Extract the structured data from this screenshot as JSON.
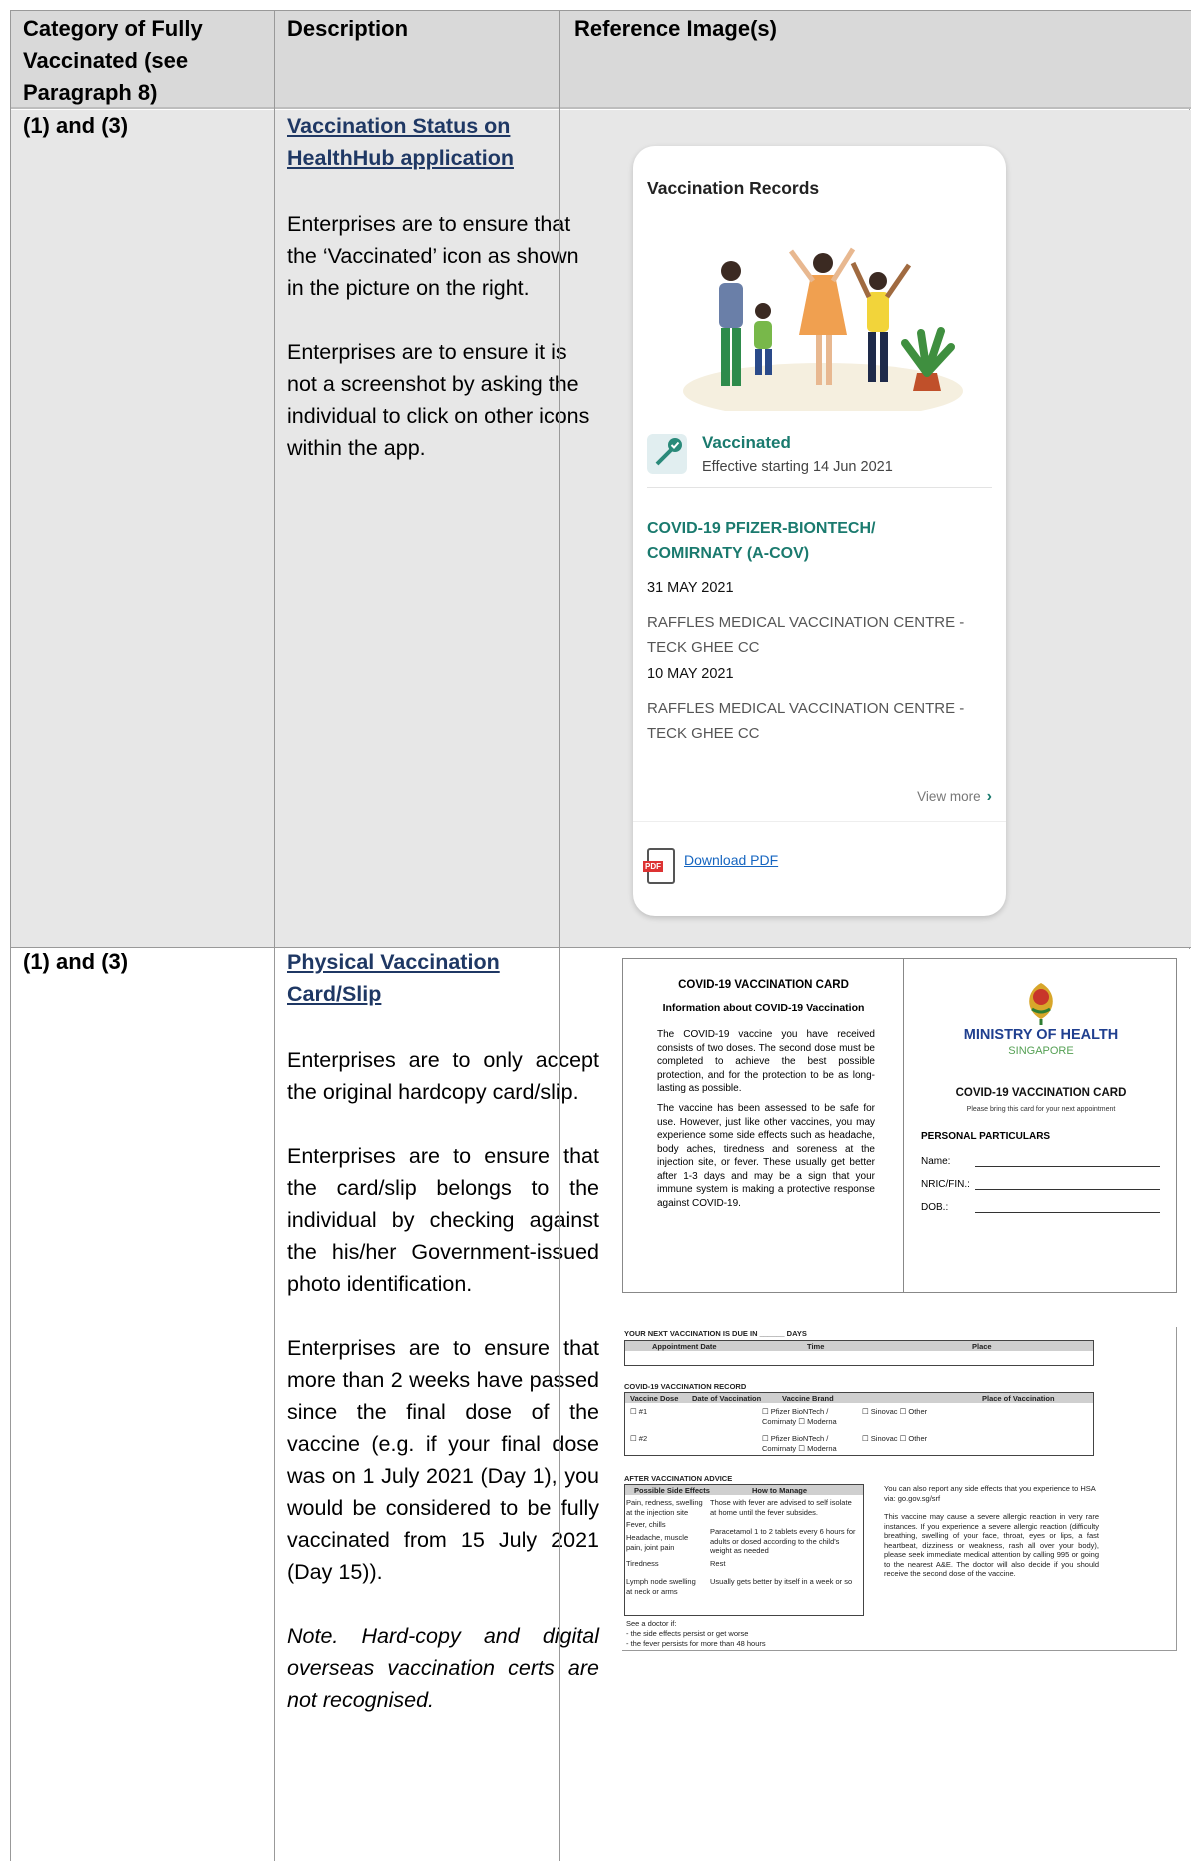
{
  "header": {
    "col1": "Category of Fully Vaccinated (see Paragraph 8)",
    "col2": "Description",
    "col3": "Reference Image(s)"
  },
  "row1": {
    "category": "(1) and (3)",
    "title": "Vaccination Status on HealthHub application",
    "para1": "Enterprises are to ensure that the ‘Vaccinated’ icon as shown in the picture on the right.",
    "para2": "Enterprises are to ensure it is not a screenshot by asking the individual to click on other icons within the app."
  },
  "app_card": {
    "heading": "Vaccination Records",
    "status": "Vaccinated",
    "effective": "Effective starting 14 Jun 2021",
    "vaccine": "COVID-19 PFIZER-BIONTECH/ COMIRNATY (A-COV)",
    "date1": "31 MAY 2021",
    "place1": "RAFFLES MEDICAL VACCINATION CENTRE - TECK GHEE CC",
    "date2": "10 MAY 2021",
    "place2": "RAFFLES MEDICAL VACCINATION CENTRE - TECK GHEE CC",
    "view_more": "View more",
    "pdf_badge": "PDF",
    "download": "Download PDF"
  },
  "row2": {
    "category": "(1) and (3)",
    "title": "Physical Vaccination Card/Slip",
    "para1": "Enterprises are to only accept the original hardcopy card/slip.",
    "para2": "Enterprises are to ensure that the card/slip belongs to the individual by checking against the his/her Government-issued photo identification.",
    "para3": "Enterprises are to ensure that more than 2 weeks have passed since the final dose of the vaccine (e.g. if your final dose was on 1 July 2021 (Day 1), you would be considered to be fully vaccinated from 15 July 2021 (Day 15)).",
    "note": "Note. Hard-copy and digital overseas vaccination certs are not recognised."
  },
  "phys_card": {
    "left_title": "COVID-19 VACCINATION CARD",
    "left_subtitle": "Information about COVID-19 Vaccination",
    "text1": "The COVID-19 vaccine you have received consists of two doses. The second dose must be completed to achieve the best possible protection, and for the protection to be as long-lasting as possible.",
    "text2": "The vaccine has been assessed to be safe for use. However, just like other vaccines, you may experience some side effects such as headache, body aches, tiredness and soreness at the injection site, or fever. These usually get better after 1-3 days and may be a sign that your immune system is making a protective response against COVID-19.",
    "ministry": "MINISTRY OF HEALTH",
    "country": "SINGAPORE",
    "right_title": "COVID-19 VACCINATION CARD",
    "right_note": "Please bring this card for your next appointment",
    "particulars": "PERSONAL PARTICULARS",
    "name": "Name:",
    "nric": "NRIC/FIN.:",
    "dob": "DOB.:"
  },
  "record_sheet": {
    "next_due": "YOUR NEXT VACCINATION IS DUE IN ______ DAYS",
    "appt": "Appointment Date",
    "time": "Time",
    "place": "Place",
    "record_title": "COVID-19 VACCINATION RECORD",
    "dose": "Vaccine Dose",
    "date": "Date of Vaccination",
    "brand": "Vaccine Brand",
    "place_vacc": "Place of Vaccination",
    "dose1": "☐ #1",
    "dose2": "☐ #2",
    "brand_opts": "☐ Pfizer BioNTech / Comirnaty ☐ Moderna",
    "brand_opts2": "☐ Sinovac ☐ Other",
    "advice": "AFTER VACCINATION ADVICE",
    "side": "Possible Side Effects",
    "manage": "How to Manage",
    "s1": "Pain, redness, swelling at the injection site",
    "s2": "Fever, chills",
    "s3": "Headache, muscle pain, joint pain",
    "s4": "Tiredness",
    "s5": "Lymph node swelling at neck or arms",
    "m1": "Those with fever are advised to self isolate at home until the fever subsides.",
    "m2": "Paracetamol 1 to 2 tablets every 6 hours for adults or dosed according to the child's weight as needed",
    "m3": "Rest",
    "m4": "Usually gets better by itself in a week or so",
    "report": "You can also report any side effects that you experience to HSA via: go.gov.sg/srf",
    "allergy": "This vaccine may cause a severe allergic reaction in very rare instances. If you experience a severe allergic reaction (difficulty breathing, swelling of your face, throat, eyes or lips, a fast heartbeat, dizziness or weakness, rash all over your body), please seek immediate medical attention by calling 995 or going to the nearest A&E. The doctor will also decide if you should receive the second dose of the vaccine.",
    "doctor": "See a doctor if:",
    "d1": "- the side effects persist or get worse",
    "d2": "- the fever persists for more than 48 hours"
  }
}
